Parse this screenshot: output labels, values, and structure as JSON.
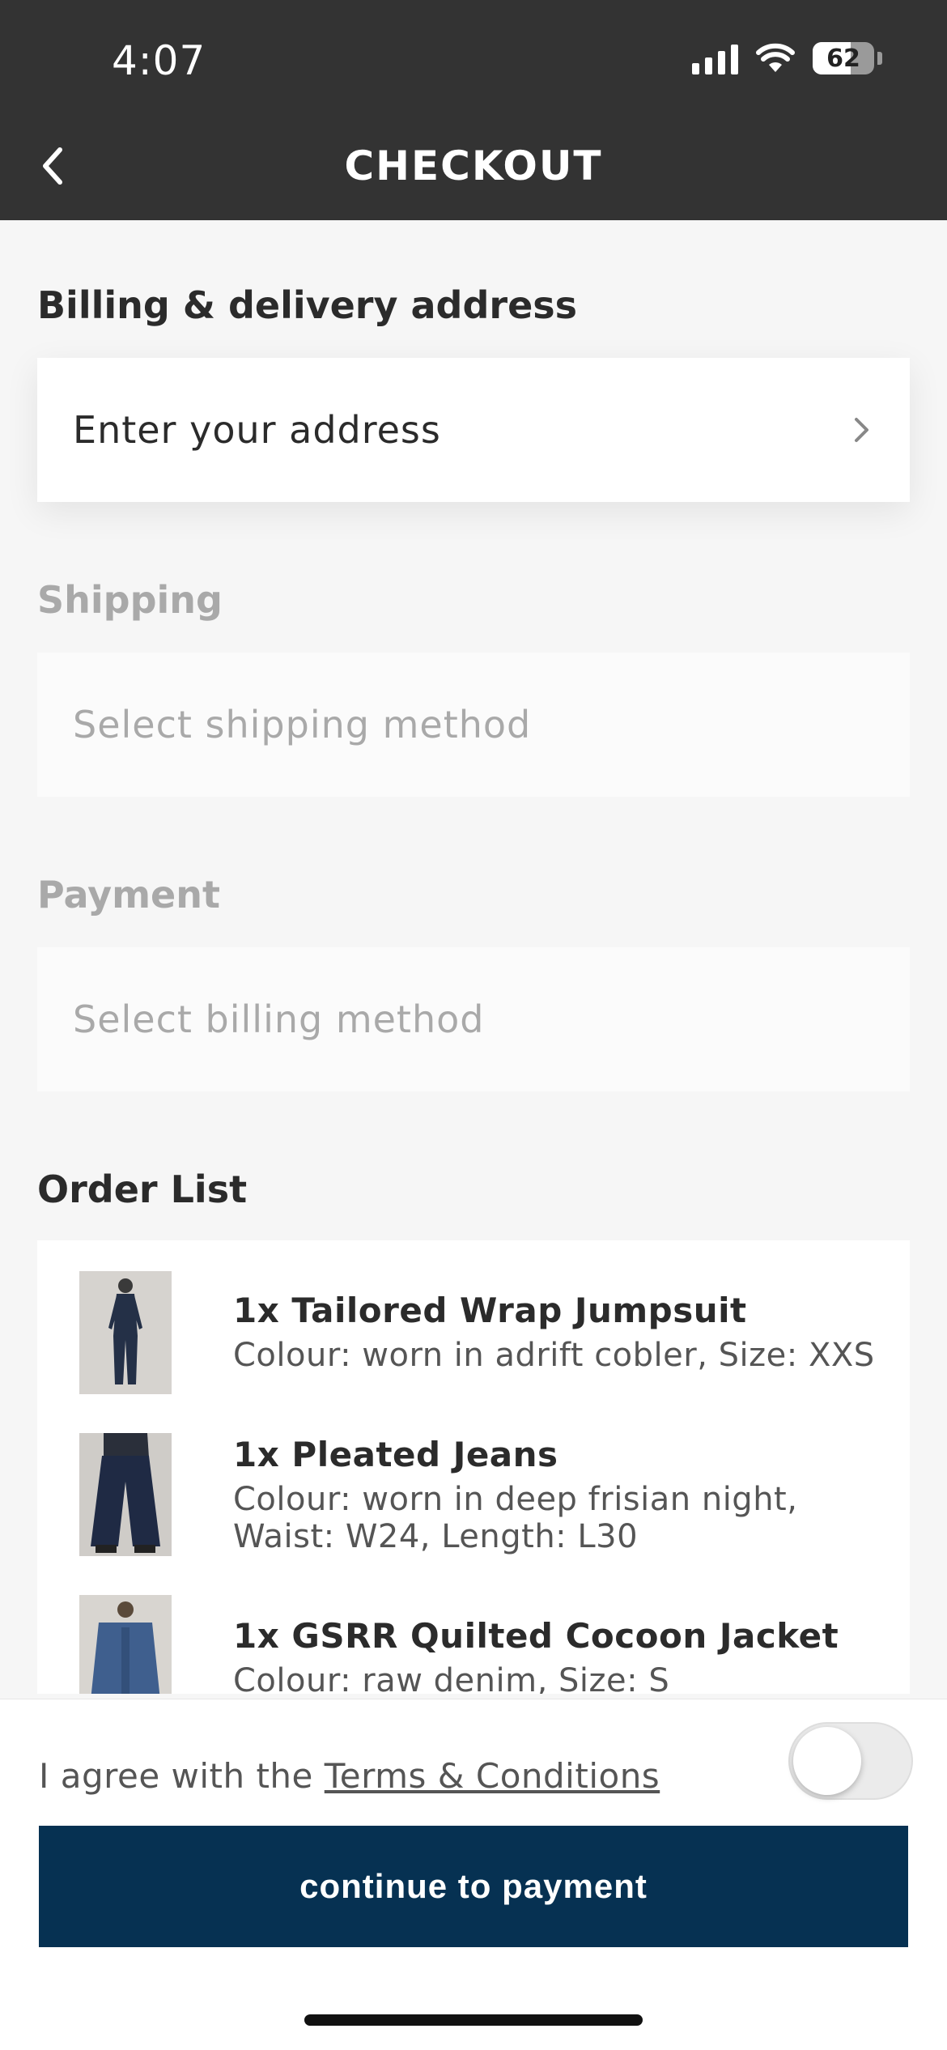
{
  "status_bar": {
    "time": "4:07",
    "battery": "62",
    "battery_level": 0.62
  },
  "nav": {
    "title": "CHECKOUT"
  },
  "billing": {
    "title": "Billing & delivery address",
    "field": "Enter your address"
  },
  "shipping": {
    "title": "Shipping",
    "field": "Select shipping method"
  },
  "payment": {
    "title": "Payment",
    "field": "Select billing method"
  },
  "order": {
    "title": "Order List",
    "items": [
      {
        "name": "1x Tailored Wrap Jumpsuit",
        "desc": "Colour: worn in adrift cobler, Size: XXS"
      },
      {
        "name": "1x Pleated Jeans",
        "desc": "Colour: worn in deep frisian night, Waist: W24, Length: L30"
      },
      {
        "name": "1x GSRR Quilted Cocoon Jacket",
        "desc": "Colour: raw denim, Size: S"
      }
    ]
  },
  "terms": {
    "prefix": "I agree with the ",
    "link": "Terms & Conditions",
    "agreed": false
  },
  "cta": {
    "label": "continue to payment"
  },
  "colors": {
    "header_bg": "#333333",
    "cta_bg": "#063152",
    "page_bg": "#f6f6f6"
  }
}
